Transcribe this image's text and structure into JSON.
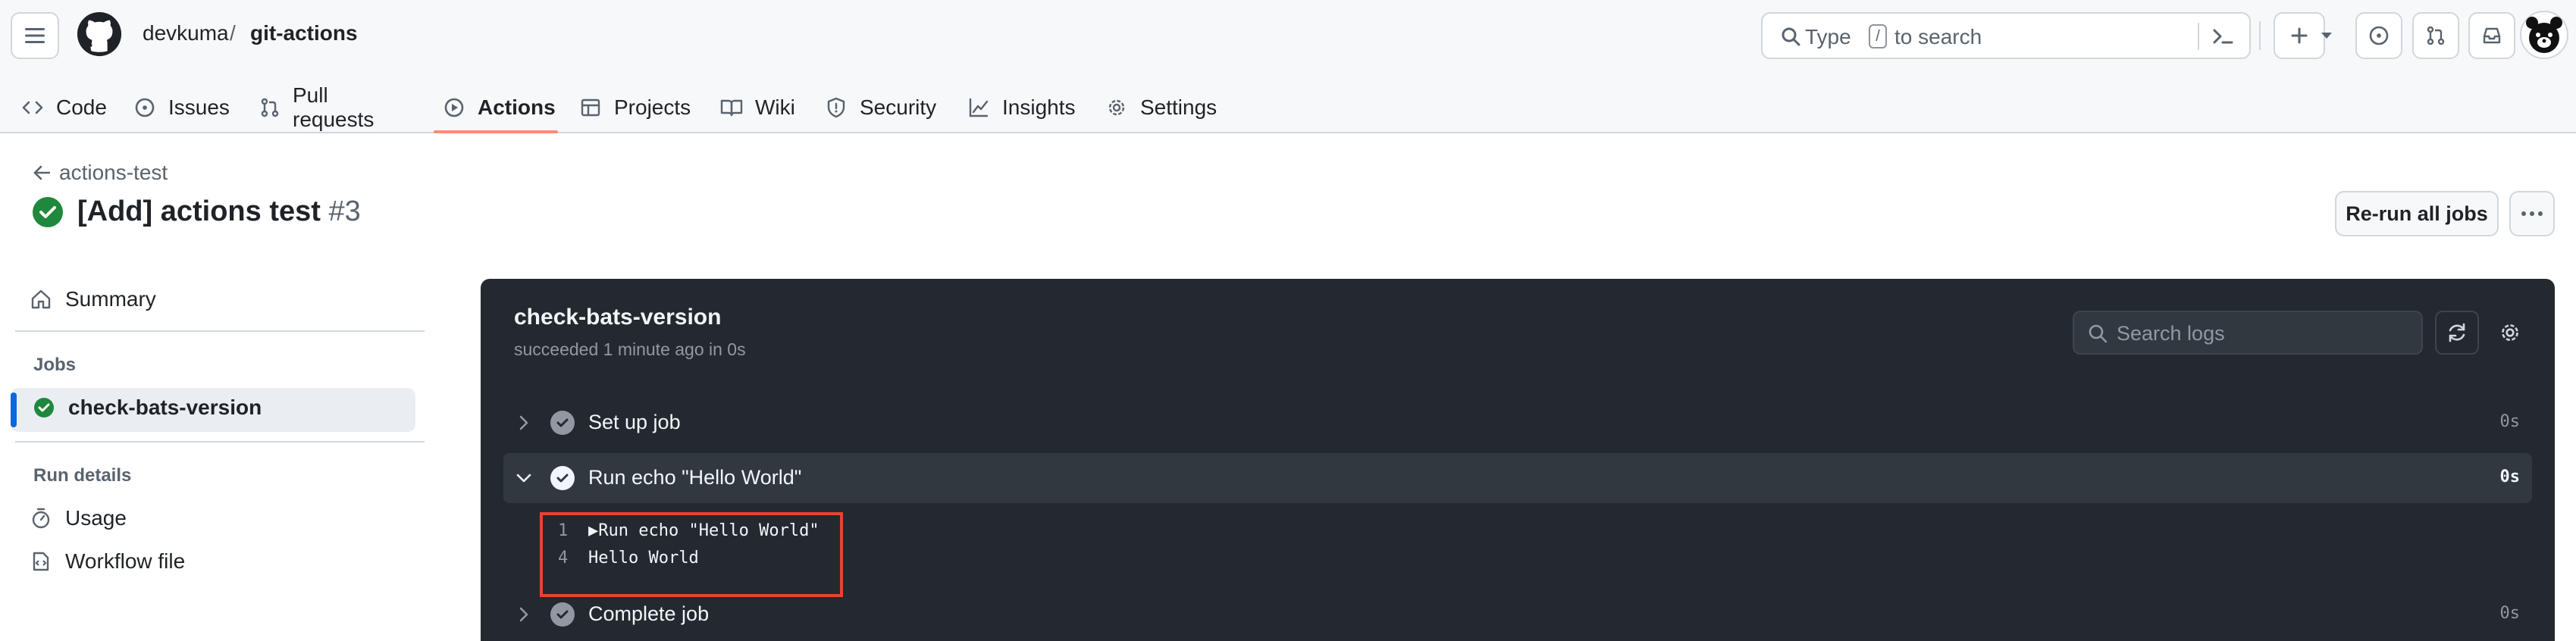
{
  "header": {
    "owner": "devkuma",
    "separator": "/",
    "repo": "git-actions",
    "search_placeholder_a": "Type",
    "search_slash": "/",
    "search_placeholder_b": "to search"
  },
  "nav": {
    "tabs": [
      {
        "label": "Code",
        "icon": "code-icon"
      },
      {
        "label": "Issues",
        "icon": "issue-icon"
      },
      {
        "label": "Pull requests",
        "icon": "pull-request-icon"
      },
      {
        "label": "Actions",
        "icon": "play-icon",
        "active": true
      },
      {
        "label": "Projects",
        "icon": "table-icon"
      },
      {
        "label": "Wiki",
        "icon": "book-icon"
      },
      {
        "label": "Security",
        "icon": "shield-icon"
      },
      {
        "label": "Insights",
        "icon": "graph-icon"
      },
      {
        "label": "Settings",
        "icon": "gear-icon"
      }
    ]
  },
  "run": {
    "back_label": "actions-test",
    "title": "[Add] actions test",
    "number": "#3",
    "rerun_label": "Re-run all jobs"
  },
  "sidebar": {
    "summary": "Summary",
    "jobs_heading": "Jobs",
    "job": "check-bats-version",
    "details_heading": "Run details",
    "usage": "Usage",
    "workflow_file": "Workflow file"
  },
  "job_panel": {
    "title": "check-bats-version",
    "subtitle": "succeeded 1 minute ago in 0s",
    "search_placeholder": "Search logs",
    "steps": [
      {
        "name": "Set up job",
        "duration": "0s",
        "expanded": false
      },
      {
        "name": "Run echo \"Hello World\"",
        "duration": "0s",
        "expanded": true
      },
      {
        "name": "Complete job",
        "duration": "0s",
        "expanded": false
      }
    ],
    "log_lines": [
      {
        "num": "1",
        "text": "Run echo \"Hello World\""
      },
      {
        "num": "4",
        "text": "Hello World"
      }
    ]
  },
  "colors": {
    "success": "#1f883d",
    "highlight_box": "#e5452e",
    "active_tab_underline": "#fd8c73",
    "selected_bar": "#0969da"
  }
}
